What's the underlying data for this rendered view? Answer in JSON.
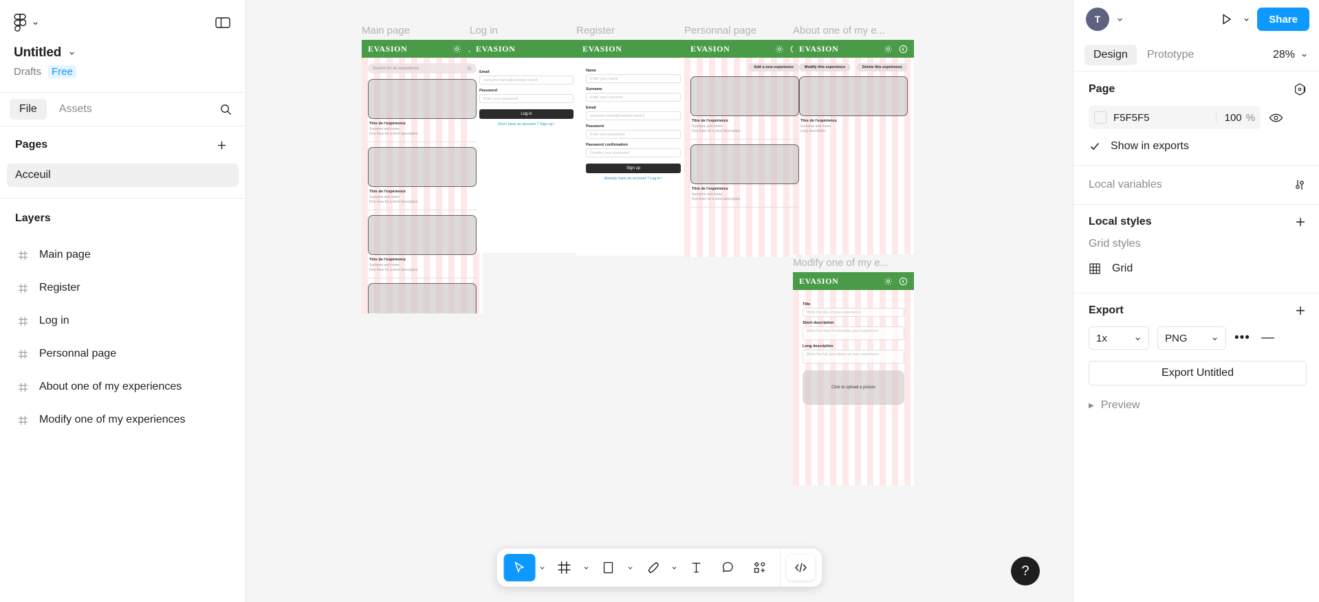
{
  "left_panel": {
    "logo_name": "figma-logo",
    "file_title": "Untitled",
    "drafts_label": "Drafts",
    "plan_badge": "Free",
    "tabs": [
      {
        "label": "File",
        "active": true
      },
      {
        "label": "Assets",
        "active": false
      }
    ],
    "pages_section": {
      "title": "Pages",
      "add_label": "+"
    },
    "pages": [
      {
        "label": "Acceuil",
        "selected": true
      }
    ],
    "layers_section": {
      "title": "Layers"
    },
    "layers": [
      {
        "label": "Main page"
      },
      {
        "label": "Register"
      },
      {
        "label": "Log in"
      },
      {
        "label": "Personnal page"
      },
      {
        "label": "About one of my experiences"
      },
      {
        "label": "Modify one of my experiences"
      }
    ]
  },
  "canvas": {
    "background": "#F5F5F5",
    "frames": [
      {
        "name": "Main page"
      },
      {
        "name": "Log in"
      },
      {
        "name": "Register"
      },
      {
        "name": "Personnal page"
      },
      {
        "name": "About one of my e..."
      },
      {
        "name": "Modify one of my e..."
      }
    ]
  },
  "mockups": {
    "brand": "EVASION",
    "brand_color": "#4A9B48",
    "main_page": {
      "search_placeholder": "Search for an experience",
      "cards": [
        {
          "title": "Titre de l'expérience",
          "subtitle": "Surname and name",
          "desc": "Five lines for a short description"
        },
        {
          "title": "Titre de l'expérience",
          "subtitle": "Surname and name",
          "desc": "Five lines for a short description"
        },
        {
          "title": "Titre de l'expérience",
          "subtitle": "Surname and name",
          "desc": "Five lines for a short description"
        }
      ]
    },
    "login": {
      "email_label": "Email",
      "email_placeholder": "surname.name@centrale-med.fr",
      "password_label": "Password",
      "password_placeholder": "Enter your password",
      "submit_label": "Log in",
      "alt_link": "Don't have an account ? Sign up !"
    },
    "register": {
      "name_label": "Name",
      "name_placeholder": "Enter your name",
      "surname_label": "Surname",
      "surname_placeholder": "Enter your surname",
      "email_label": "Email",
      "email_placeholder": "surname.name@centrale-med.fr",
      "password_label": "Password",
      "password_placeholder": "Enter your password",
      "confirm_label": "Password confirmation",
      "confirm_placeholder": "Confirm your password",
      "submit_label": "Sign up",
      "alt_link": "Already have an account ? Log in !"
    },
    "personal_page": {
      "add_button": "Add a new experience",
      "cards": [
        {
          "title": "Titre de l'expérience",
          "subtitle": "Surname and name",
          "desc": "Five lines for a short description"
        },
        {
          "title": "Titre de l'expérience",
          "subtitle": "Surname and name",
          "desc": "Five lines for a short description"
        }
      ]
    },
    "about_experience": {
      "modify_button": "Modify this experience",
      "delete_button": "Delete this experience",
      "title": "Titre de l'expérience",
      "subtitle": "Surname and name",
      "desc": "Long description"
    },
    "modify_experience": {
      "title_label": "Title",
      "title_placeholder": "Write the title of your experience",
      "short_label": "Short description",
      "short_placeholder": "Write few lines to describe your experience",
      "long_label": "Long description",
      "long_placeholder": "Write the full description of your experience",
      "upload_label": "Click to upload a picture"
    }
  },
  "toolbar": {
    "tools": [
      {
        "name": "move-tool",
        "active": true
      },
      {
        "name": "frame-tool",
        "active": false
      },
      {
        "name": "shape-tool",
        "active": false
      },
      {
        "name": "pen-tool",
        "active": false
      },
      {
        "name": "text-tool",
        "active": false
      },
      {
        "name": "comment-tool",
        "active": false
      },
      {
        "name": "actions-tool",
        "active": false
      }
    ],
    "code_tool": "</>",
    "help_label": "?"
  },
  "right_panel": {
    "avatar_initial": "T",
    "share_label": "Share",
    "tabs": [
      {
        "label": "Design",
        "active": true
      },
      {
        "label": "Prototype",
        "active": false
      }
    ],
    "zoom_level": "28%",
    "page_section": {
      "title": "Page"
    },
    "page_fill": {
      "hex": "F5F5F5",
      "opacity": "100",
      "pct": "%"
    },
    "show_in_exports": "Show in exports",
    "local_variables": {
      "title": "Local variables"
    },
    "local_styles": {
      "title": "Local styles",
      "add": "+"
    },
    "grid_styles": {
      "title": "Grid styles",
      "items": [
        {
          "label": "Grid"
        }
      ]
    },
    "export": {
      "title": "Export",
      "add": "+",
      "scale": "1x",
      "format": "PNG",
      "more": "•••",
      "remove": "—",
      "button_label": "Export Untitled",
      "preview_label": "Preview"
    }
  }
}
